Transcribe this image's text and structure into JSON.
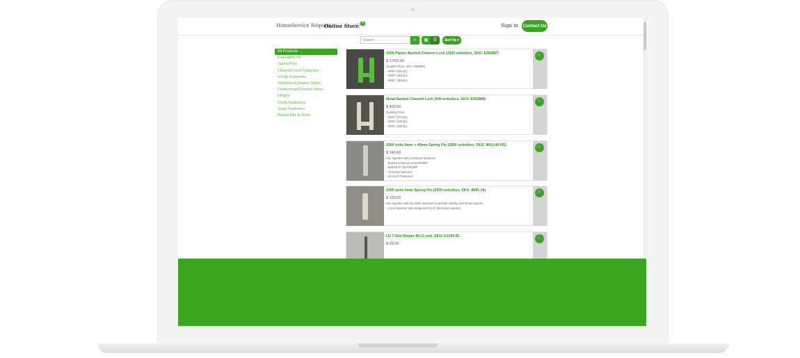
{
  "nav": {
    "home": "Home",
    "service": "Service Request",
    "store": "Online Store",
    "cart_count": "0",
    "signin": "Sign in",
    "contact": "Contact Us"
  },
  "toolbar": {
    "search_placeholder": "Search...",
    "sort_label": "Sort by ▾"
  },
  "sidebar": {
    "items": [
      {
        "label": "All Products",
        "active": true
      },
      {
        "label": "Evaluation Kit"
      },
      {
        "label": "Spring Pins"
      },
      {
        "label": "Channel Lock Fasteners"
      },
      {
        "label": "H-Clip Fasteners"
      },
      {
        "label": "Sidemount Drawer Slides"
      },
      {
        "label": "Undermount Drawer Slides"
      },
      {
        "label": "Hinges"
      },
      {
        "label": "Cinch Fasteners"
      },
      {
        "label": "Snap Fasteners"
      },
      {
        "label": "Router Bits & Tools"
      }
    ]
  },
  "products": [
    {
      "name": "2000 Plastic Barbed Channel Lock (2000 units/box, SKU: E900BP)",
      "price": "$ 1,000.00",
      "desc": "Quantity Price: SKU: E900BP)\n- 2000+ [50¢/pc]\n- 4000+ [45¢/pc]\n- 8000+ [35¢/pc]"
    },
    {
      "name": "Metal Barbed Channel Lock (500 units/box, SKU: E900BM)",
      "price": "$ 400.00",
      "desc": "Quantity Price:\n- 2000+ [57¢/pc]\n- 4000+ [54¢/pc]\n- 8000+ [44¢/pc]"
    },
    {
      "name": "2000 units 8mm x 40mm Spring Pin (2000 units/box, SKU: 8002-40-RS)",
      "price": "$ 140.00",
      "desc": "Use together with Lockdowel products:\n- Barbed Channel Lock E900BP\n- Barbed H-Clip E910BP\n- All Snap Fasteners\n- All Cinch Fasteners"
    },
    {
      "name": "2000 units 5mm Spring Pin (2000 units/box, SKU: 8005-36)",
      "price": "$ 120.00",
      "desc": "Use together with our other fasteners to provide stability and shear support.\n- 5 mm diameter was designed for 1/2\" thickness material."
    },
    {
      "name": "LD T-Slot Router Bit (1 unit, SKU: E1000-B)",
      "price": "$ 69.00",
      "desc": ""
    }
  ],
  "colors": {
    "accent": "#3aa51e"
  }
}
